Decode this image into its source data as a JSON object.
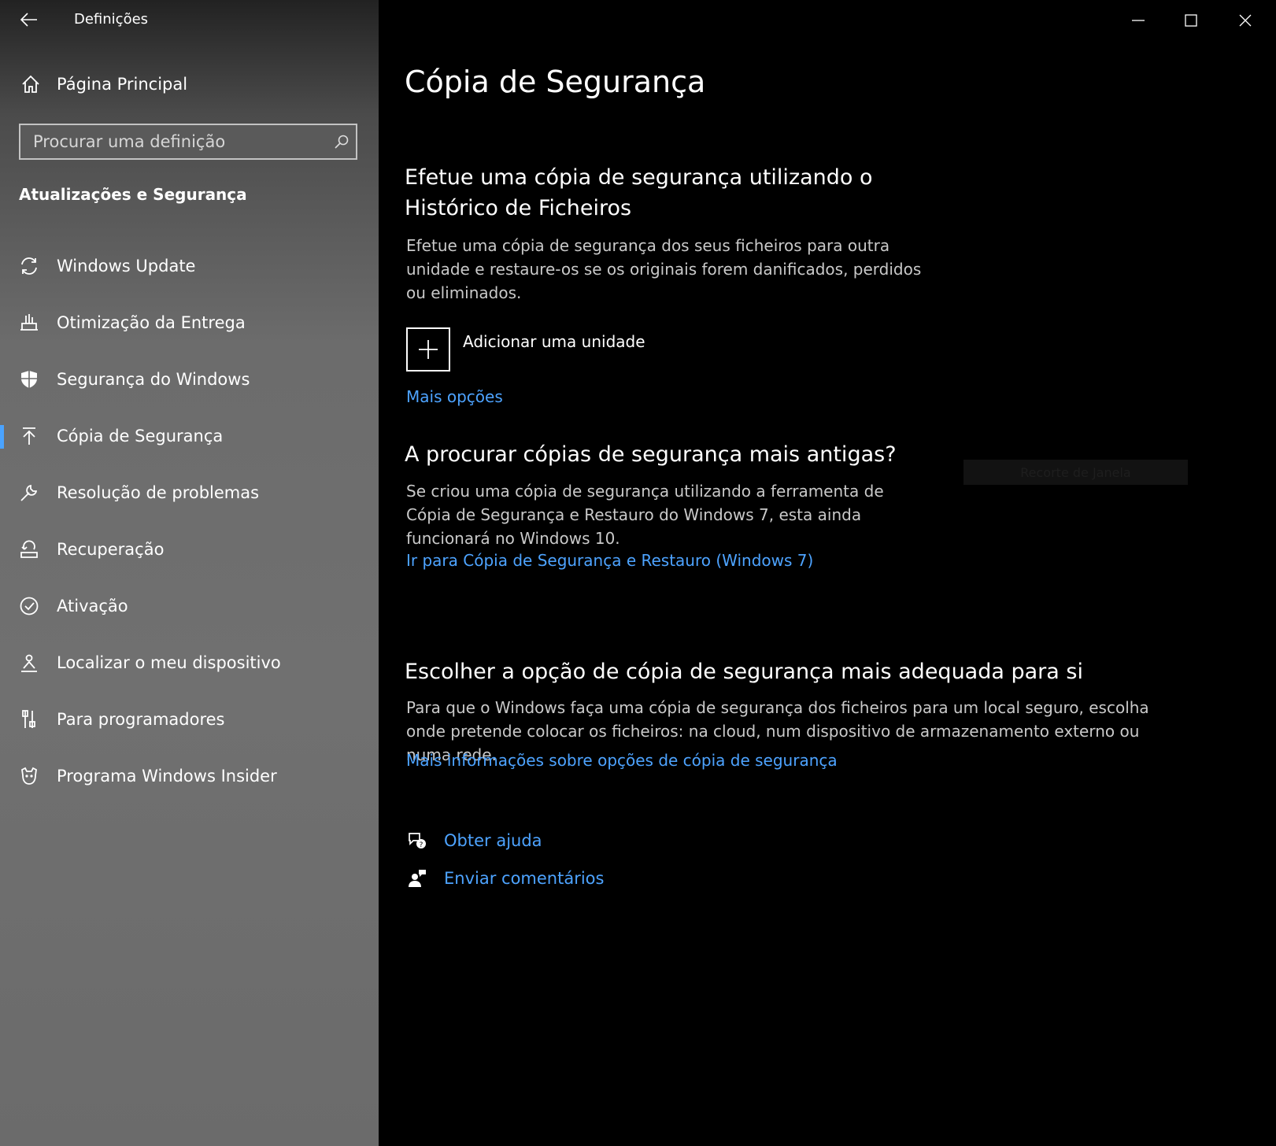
{
  "app": {
    "title": "Definições"
  },
  "sidebar": {
    "home_label": "Página Principal",
    "search": {
      "placeholder": "Procurar uma definição",
      "value": ""
    },
    "section_title": "Atualizações e Segurança",
    "items": [
      {
        "label": "Windows Update",
        "icon": "sync-icon"
      },
      {
        "label": "Otimização da Entrega",
        "icon": "delivery-icon"
      },
      {
        "label": "Segurança do Windows",
        "icon": "shield-icon"
      },
      {
        "label": "Cópia de Segurança",
        "icon": "backup-arrow-icon",
        "active": true
      },
      {
        "label": "Resolução de problemas",
        "icon": "wrench-icon"
      },
      {
        "label": "Recuperação",
        "icon": "recovery-icon"
      },
      {
        "label": "Ativação",
        "icon": "check-circle-icon"
      },
      {
        "label": "Localizar o meu dispositivo",
        "icon": "person-locate-icon"
      },
      {
        "label": "Para programadores",
        "icon": "developer-tools-icon"
      },
      {
        "label": "Programa Windows Insider",
        "icon": "insider-icon"
      }
    ]
  },
  "window_controls": {
    "minimize": "minimize-icon",
    "maximize": "maximize-icon",
    "close": "close-icon"
  },
  "main": {
    "title": "Cópia de Segurança",
    "file_history": {
      "heading": "Efetue uma cópia de segurança utilizando o Histórico de Ficheiros",
      "description": "Efetue uma cópia de segurança dos seus ficheiros para outra unidade e restaure-os se os originais forem danificados, perdidos ou eliminados.",
      "add_drive_label": "Adicionar uma unidade",
      "more_options": "Mais opções"
    },
    "older_backups": {
      "heading": "A procurar cópias de segurança mais antigas?",
      "description": "Se criou uma cópia de segurança utilizando a ferramenta de Cópia de Segurança e Restauro do Windows 7, esta ainda funcionará no Windows 10.",
      "link": "Ir para Cópia de Segurança e Restauro (Windows 7)"
    },
    "best_option": {
      "heading": "Escolher a opção de cópia de segurança mais adequada para si",
      "description": "Para que o Windows faça uma cópia de segurança dos ficheiros para um local seguro, escolha onde pretende colocar os ficheiros: na cloud, num dispositivo de armazenamento externo ou numa rede.",
      "link": "Mais informações sobre opções de cópia de segurança"
    },
    "help": {
      "get_help": "Obter ajuda",
      "feedback": "Enviar comentários"
    },
    "overlay_ghost": "Recorte de Janela"
  },
  "colors": {
    "accent": "#4da3ff",
    "active_bar": "#4aa3ff",
    "background": "#000000"
  }
}
